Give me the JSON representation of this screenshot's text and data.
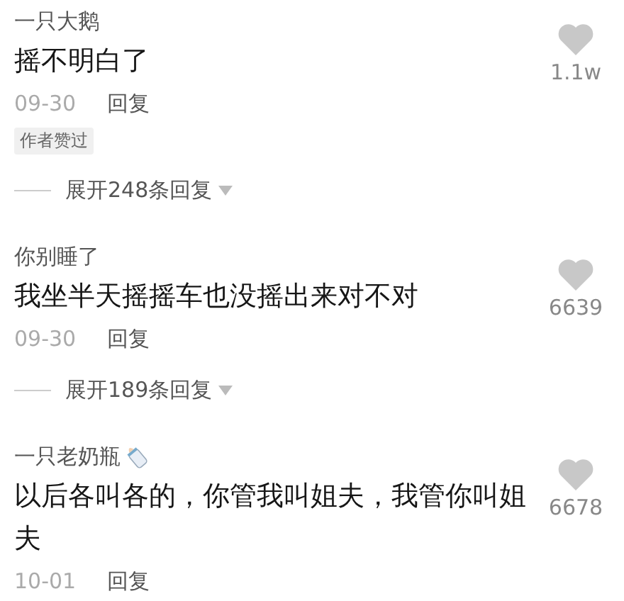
{
  "comments": [
    {
      "author": "一只大鹅",
      "has_emoji": false,
      "text": "摇不明白了",
      "likes": "1.1w",
      "date": "09-30",
      "reply": "回复",
      "badge": "作者赞过",
      "expand": "展开248条回复"
    },
    {
      "author": "你别睡了",
      "has_emoji": false,
      "text": "我坐半天摇摇车也没摇出来对不对",
      "likes": "6639",
      "date": "09-30",
      "reply": "回复",
      "expand": "展开189条回复"
    },
    {
      "author": "一只老奶瓶",
      "has_emoji": true,
      "text": "以后各叫各的，你管我叫姐夫，我管你叫姐夫",
      "likes": "6678",
      "date": "10-01",
      "reply": "回复"
    }
  ]
}
